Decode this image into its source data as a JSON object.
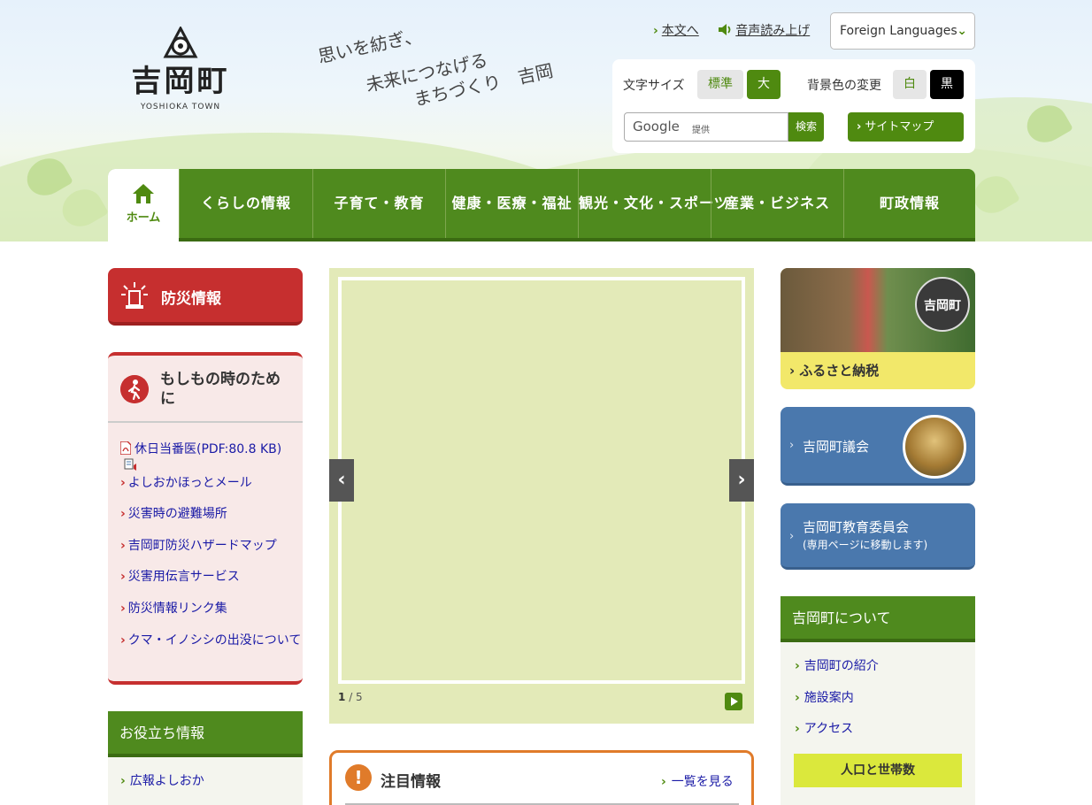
{
  "header": {
    "logo_name": "吉岡町",
    "logo_roman": "YOSHIOKA TOWN",
    "catch_line1": "思いを紡ぎ、",
    "catch_line2": "未来につなげる",
    "catch_line3": "まちづくり　吉岡",
    "skip_link": "本文へ",
    "read_aloud": "音声読み上げ",
    "foreign_languages": "Foreign Languages",
    "font_size_label": "文字サイズ",
    "font_size_standard": "標準",
    "font_size_large": "大",
    "bg_color_label": "背景色の変更",
    "bg_white": "白",
    "bg_black": "黒",
    "google_label": "Google",
    "google_provided": "提供",
    "search_button": "検索",
    "sitemap_button": "サイトマップ"
  },
  "nav": {
    "home": "ホーム",
    "items": [
      "くらしの情報",
      "子育て・教育",
      "健康・医療・福祉",
      "観光・文化・スポーツ",
      "産業・ビジネス",
      "町政情報"
    ]
  },
  "left": {
    "bousai_title": "防災情報",
    "moshimo_title": "もしもの時のために",
    "moshimo_links": [
      "休日当番医(PDF:80.8 KB)",
      "よしおかほっとメール",
      "災害時の避難場所",
      "吉岡町防災ハザードマップ",
      "災害用伝言サービス",
      "防災情報リンク集",
      "クマ・イノシシの出没について"
    ],
    "oyaku_title": "お役立ち情報",
    "oyaku_links": [
      "広報よしおか"
    ]
  },
  "center": {
    "slide_current": "1",
    "slide_total": "/ 5",
    "featured_title": "注目情報",
    "featured_link": "一覧を見る"
  },
  "right": {
    "furusato_seal": "吉岡町",
    "furusato_title": "ふるさと納税",
    "gikai_title": "吉岡町議会",
    "kyoiku_title": "吉岡町教育委員会",
    "kyoiku_sub": "(専用ページに移動します)",
    "about_title": "吉岡町について",
    "about_links": [
      "吉岡町の紹介",
      "施設案内",
      "アクセス"
    ],
    "population_button": "人口と世帯数"
  },
  "colors": {
    "brand_green": "#4f8a1e",
    "alert_red": "#c62f2f",
    "link_blue": "#1a1aa6",
    "accent_orange": "#e07b2a",
    "council_blue": "#4a78ad"
  }
}
